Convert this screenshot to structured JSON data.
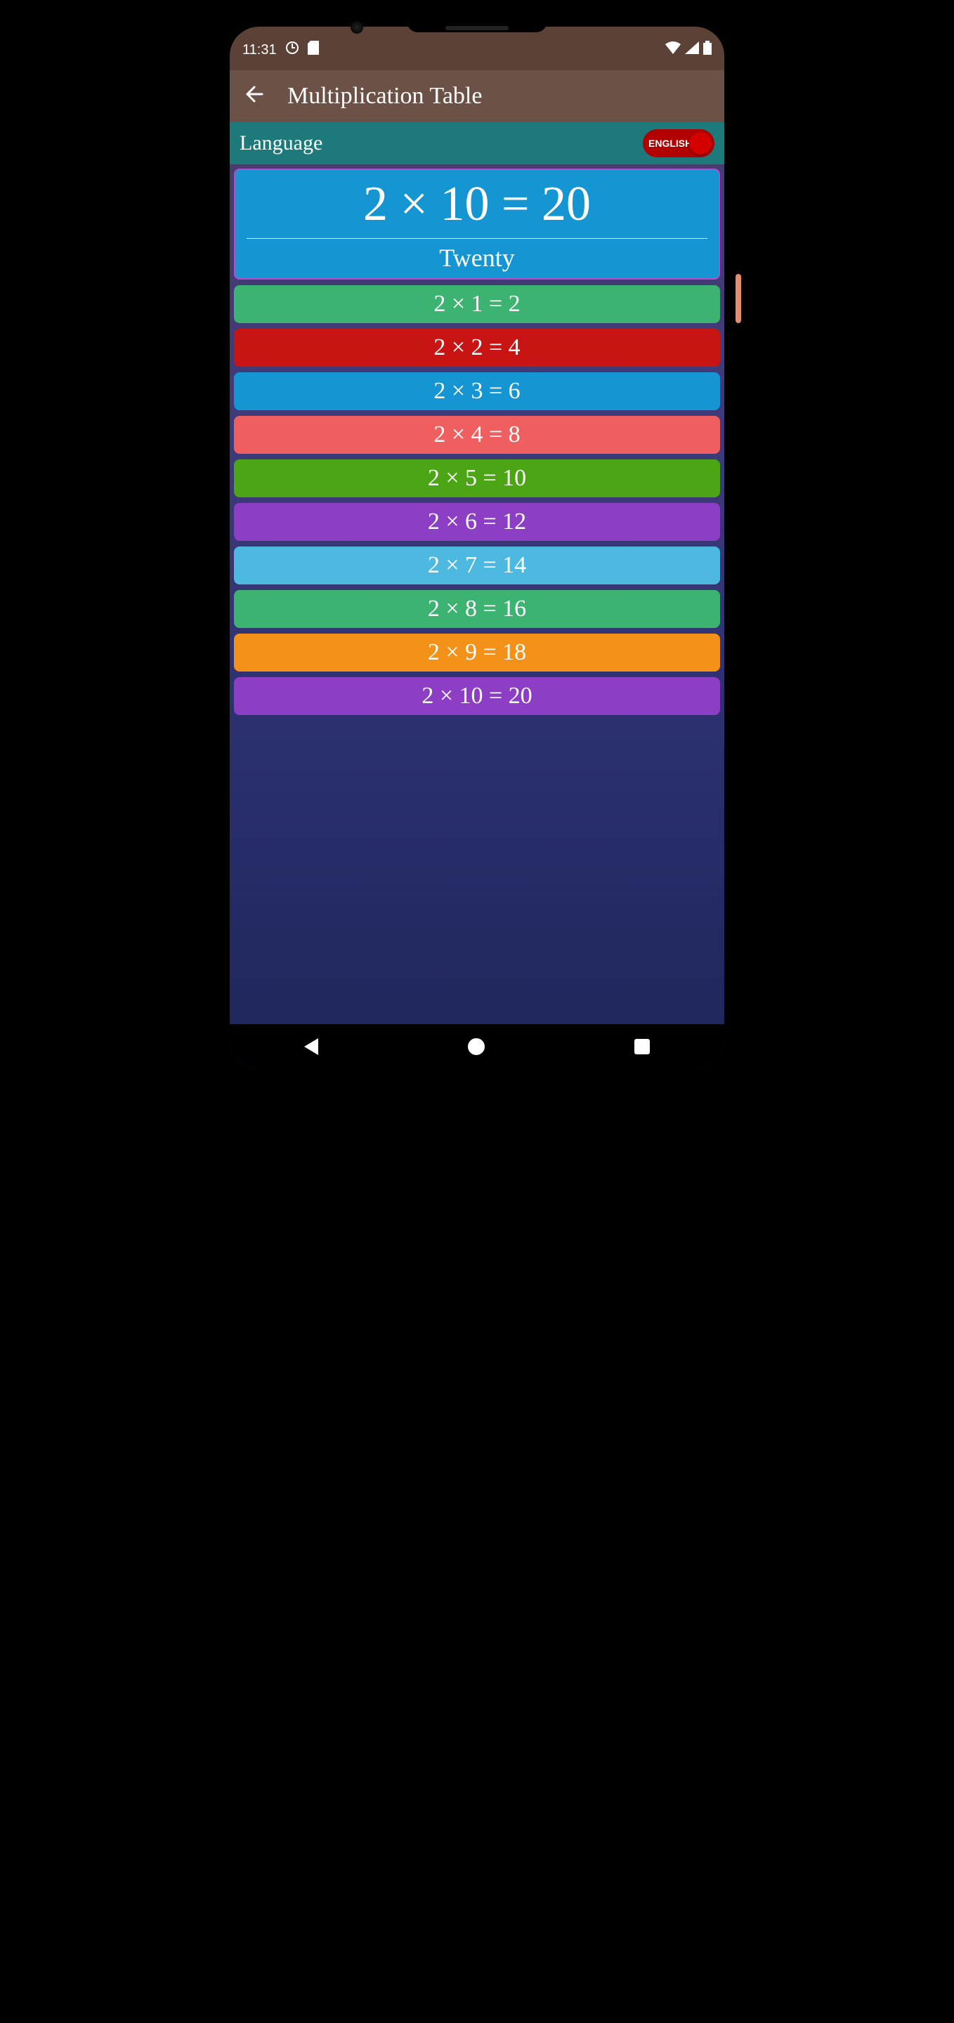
{
  "status": {
    "time": "11:31",
    "icons_left": [
      "clock-icon",
      "sd-card-icon"
    ],
    "icons_right": [
      "wifi-icon",
      "signal-icon",
      "battery-icon"
    ]
  },
  "appbar": {
    "title": "Multiplication Table"
  },
  "language": {
    "label": "Language",
    "toggle_text": "ENGLISH"
  },
  "hero": {
    "equation": "2 × 10 = 20",
    "word": "Twenty"
  },
  "rows": [
    {
      "text": "2 × 1 = 2",
      "color": "#3cb371"
    },
    {
      "text": "2 × 2 = 4",
      "color": "#c91414"
    },
    {
      "text": "2 × 3 = 6",
      "color": "#1596d2"
    },
    {
      "text": "2 × 4 = 8",
      "color": "#ef5f5f"
    },
    {
      "text": "2 × 5 = 10",
      "color": "#4ca514"
    },
    {
      "text": "2 × 6 = 12",
      "color": "#8c3fc4"
    },
    {
      "text": "2 × 7 = 14",
      "color": "#4db8e0"
    },
    {
      "text": "2 × 8 = 16",
      "color": "#3cb371"
    },
    {
      "text": "2 × 9 = 18",
      "color": "#f39118"
    },
    {
      "text": "2 × 10 = 20",
      "color": "#8c3fc4"
    }
  ]
}
